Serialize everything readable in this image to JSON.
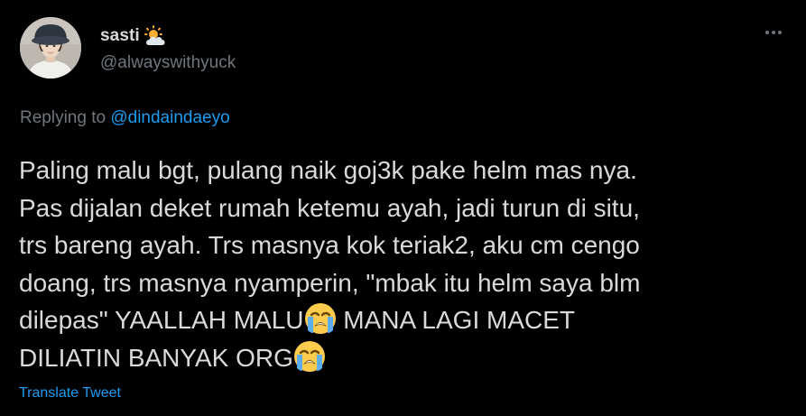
{
  "author": {
    "display_name": "sasti",
    "handle": "@alwayswithyuck",
    "name_badge_icon": "sun-behind-cloud-icon",
    "avatar_icon": "profile-photo"
  },
  "menu": {
    "more_icon": "more-options-icon"
  },
  "reply": {
    "prefix": "Replying to",
    "mention": "@dindaindaeyo"
  },
  "tweet": {
    "line1": "Paling malu bgt, pulang naik goj3k pake helm mas nya.",
    "line2": "Pas dijalan deket rumah ketemu ayah, jadi turun di situ,",
    "line3": "trs bareng ayah. Trs masnya kok teriak2, aku cm cengo",
    "line4": "doang, trs masnya nyamperin, \"mbak itu helm saya blm",
    "line5_part1": "dilepas\" YAALLAH MALU",
    "line5_part2": " MANA LAGI MACET",
    "line6_part1": "DILIATIN BANYAK ORG",
    "emoji_icon": "loudly-crying-face-icon"
  },
  "translate": {
    "label": "Translate Tweet"
  },
  "colors": {
    "background": "#000000",
    "text_primary": "#d9d9d9",
    "text_secondary": "#6e767d",
    "accent": "#1d9bf0"
  }
}
